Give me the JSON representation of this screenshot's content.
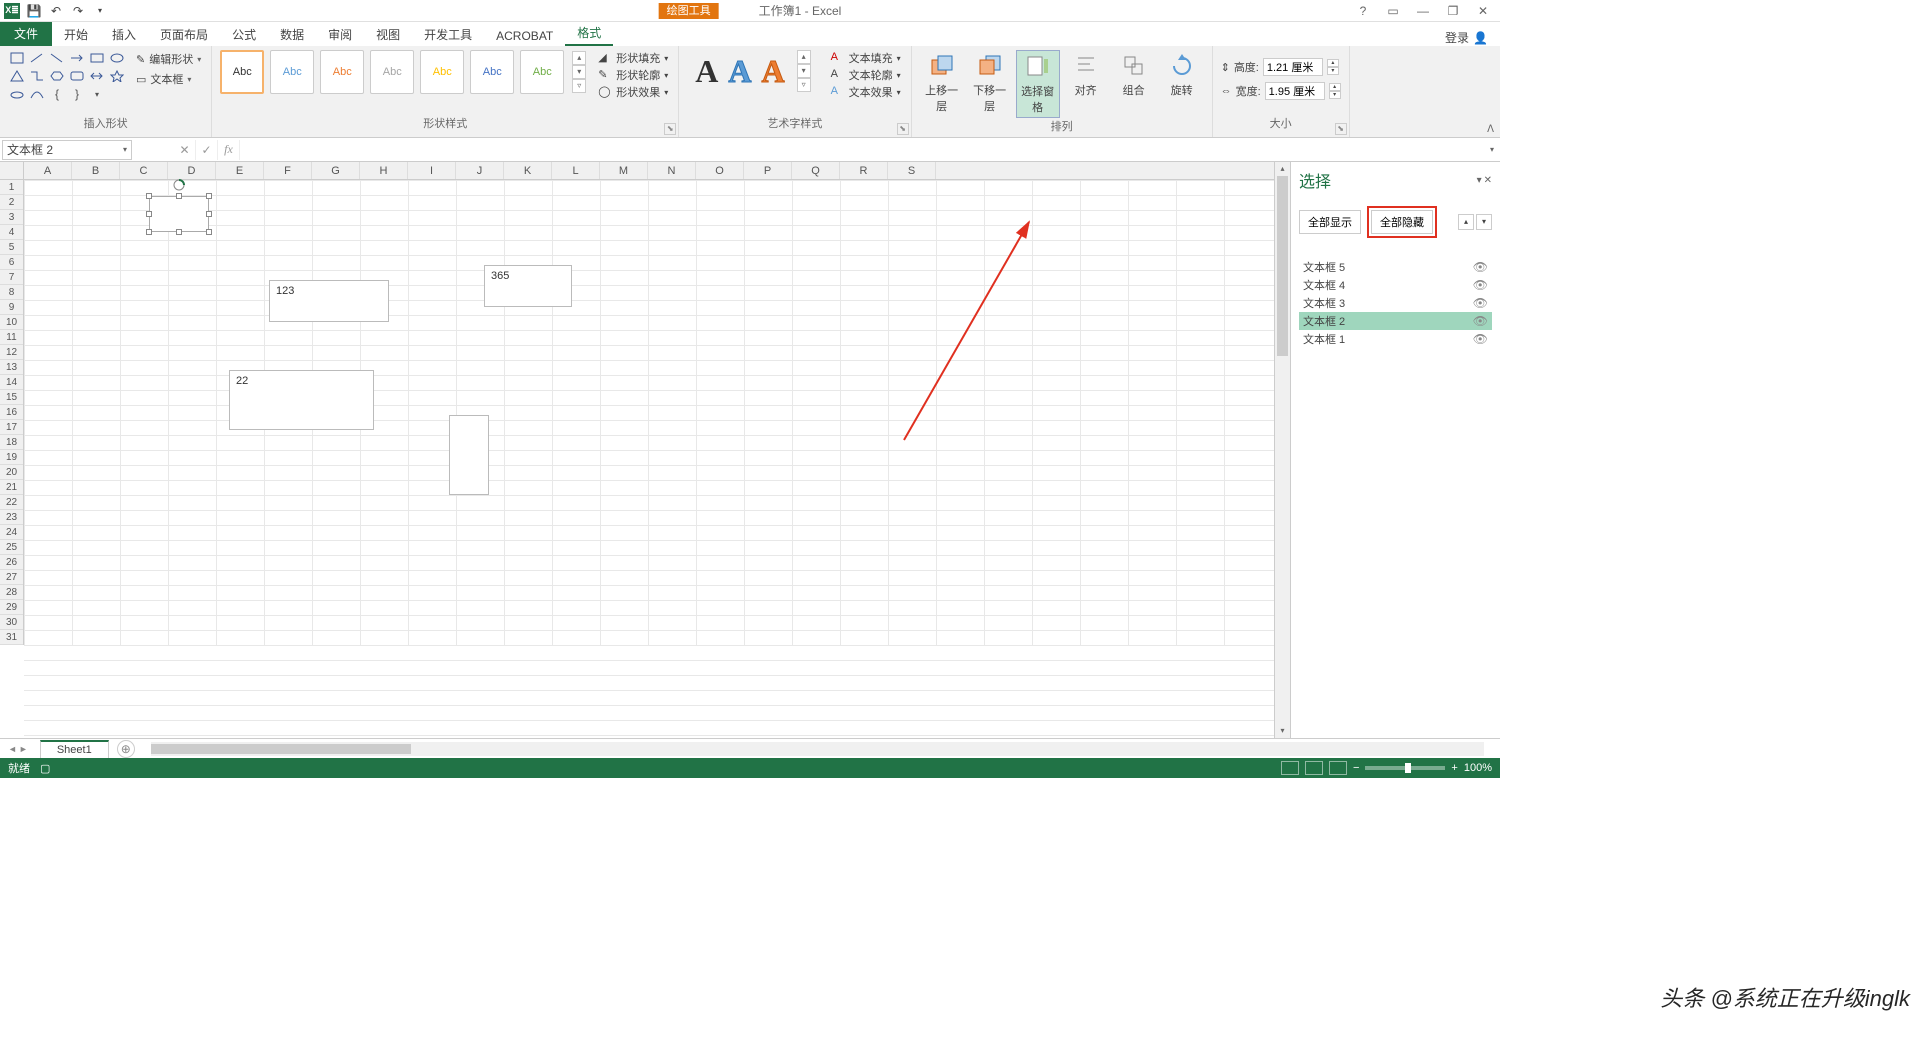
{
  "titlebar": {
    "tool_context": "绘图工具",
    "doc_title": "工作簿1 - Excel",
    "help": "?",
    "ribbon_opts": "▭",
    "minimize": "—",
    "restore": "❐",
    "close": "✕"
  },
  "tabs": {
    "file": "文件",
    "home": "开始",
    "insert": "插入",
    "layout": "页面布局",
    "formulas": "公式",
    "data": "数据",
    "review": "审阅",
    "view": "视图",
    "dev": "开发工具",
    "acrobat": "ACROBAT",
    "format": "格式",
    "login": "登录"
  },
  "ribbon": {
    "insert_shapes": {
      "edit_shape": "编辑形状",
      "text_box": "文本框",
      "label": "插入形状"
    },
    "shape_styles": {
      "swatch": "Abc",
      "fill": "形状填充",
      "outline": "形状轮廓",
      "effects": "形状效果",
      "label": "形状样式"
    },
    "wordart": {
      "text_fill": "文本填充",
      "text_outline": "文本轮廓",
      "text_effects": "文本效果",
      "label": "艺术字样式"
    },
    "arrange": {
      "bring_forward": "上移一层",
      "send_backward": "下移一层",
      "selection_pane": "选择窗格",
      "align": "对齐",
      "group": "组合",
      "rotate": "旋转",
      "label": "排列"
    },
    "size": {
      "height_label": "高度:",
      "height_value": "1.21 厘米",
      "width_label": "宽度:",
      "width_value": "1.95 厘米",
      "label": "大小"
    }
  },
  "name_box": "文本框 2",
  "columns": [
    "A",
    "B",
    "C",
    "D",
    "E",
    "F",
    "G",
    "H",
    "I",
    "J",
    "K",
    "L",
    "M",
    "N",
    "O",
    "P",
    "Q",
    "R",
    "S"
  ],
  "textboxes": {
    "tb2": "",
    "tb3": "123",
    "tb4": "22",
    "tb5": "365"
  },
  "selection_pane": {
    "title": "选择",
    "show_all": "全部显示",
    "hide_all": "全部隐藏",
    "items": [
      "文本框 5",
      "文本框 4",
      "文本框 3",
      "文本框 2",
      "文本框 1"
    ],
    "selected_index": 3
  },
  "sheet_tab": "Sheet1",
  "status": {
    "ready": "就绪",
    "zoom": "100%"
  },
  "watermark": "头条 @系统正在升级inglk"
}
